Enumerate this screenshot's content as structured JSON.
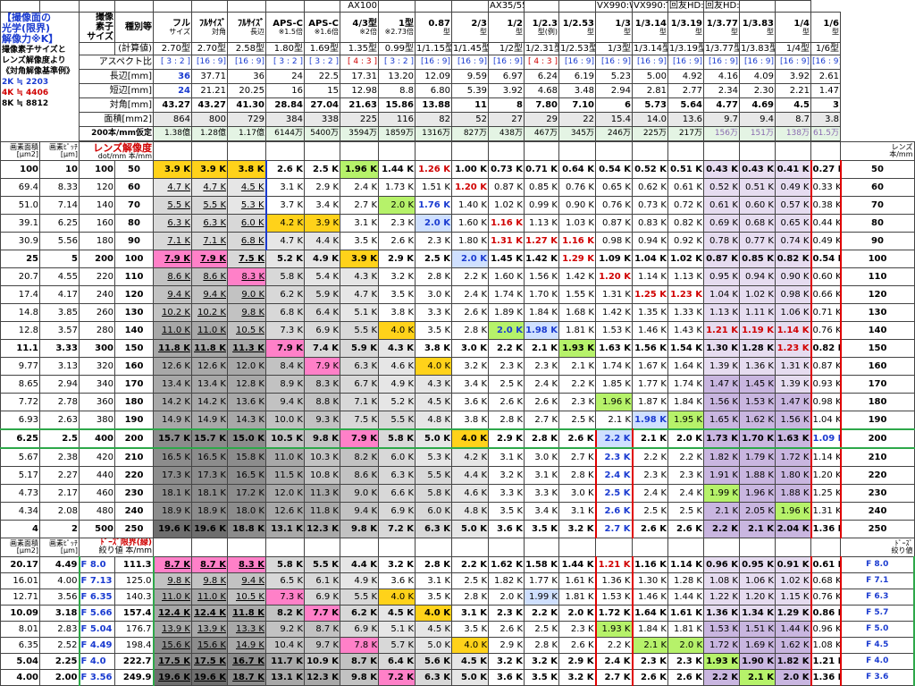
{
  "title_lines": [
    "【撮像面の",
    "光学(限界)",
    "解像力※K】",
    "撮像素子サイズと",
    "レンズ解像度より",
    "《対角解像基準例》",
    "2K ≒ 2203",
    "4K ≒ 4406",
    "8K ≒ 8812"
  ],
  "top_captions": {
    "ax100": "AX100",
    "ax35": "AX35/55",
    "vx990w": "VX990:W",
    "vx990t": "VX990:T",
    "hdw": "回友HD:W",
    "hdt": "回友HD:T"
  },
  "hdr_labels": {
    "sensor": "撮像",
    "element": "素子",
    "size": "サイズ",
    "type": "種別等",
    "calc": "(計算値)",
    "aspect": "アスペクト比",
    "long": "長辺[mm]",
    "short": "短辺[mm]",
    "diag": "対角[mm]",
    "area": "面積[mm2]",
    "pix200": "200本/mm仮定"
  },
  "columns": [
    {
      "name": "フル\nサイズ",
      "sub": "2.70型",
      "aspect": "[ 3 : 2 ]",
      "long": "36",
      "short": "24",
      "diag": "43.27",
      "area": "864",
      "pix": "1.38億"
    },
    {
      "name": "ﾌﾙｻｲｽﾞ\n対角",
      "sub": "2.70型",
      "aspect": "[16 : 9]",
      "long": "37.71",
      "short": "21.21",
      "diag": "43.27",
      "area": "800",
      "pix": "1.28億"
    },
    {
      "name": "ﾌﾙｻｲｽﾞ\n長辺",
      "sub": "2.58型",
      "aspect": "[16 : 9]",
      "long": "36",
      "short": "20.25",
      "diag": "41.30",
      "area": "729",
      "pix": "1.17億"
    },
    {
      "name": "APS-C\n※1.5倍",
      "sub": "1.80型",
      "aspect": "[ 3 : 2 ]",
      "long": "24",
      "short": "16",
      "diag": "28.84",
      "area": "384",
      "pix": "6144万"
    },
    {
      "name": "APS-C\n※1.6倍",
      "sub": "1.69型",
      "aspect": "[ 3 : 2 ]",
      "long": "22.5",
      "short": "15",
      "diag": "27.04",
      "area": "338",
      "pix": "5400万"
    },
    {
      "name": "4/3型\n※2倍",
      "sub": "1.35型",
      "aspect": "[ 4 : 3 ]",
      "long": "17.31",
      "short": "12.98",
      "diag": "21.63",
      "area": "225",
      "pix": "3594万"
    },
    {
      "name": "1型\n※2.73倍",
      "sub": "0.99型",
      "aspect": "[ 3 : 2 ]",
      "long": "13.20",
      "short": "8.8",
      "diag": "15.86",
      "area": "116",
      "pix": "1859万"
    },
    {
      "name": "0.87\n型",
      "sub": "1/1.15型",
      "aspect": "[16 : 9]",
      "long": "12.09",
      "short": "6.80",
      "diag": "13.88",
      "area": "82",
      "pix": "1316万"
    },
    {
      "name": "2/3\n型",
      "sub": "1/1.45型",
      "aspect": "[16 : 9]",
      "long": "9.59",
      "short": "5.39",
      "diag": "11",
      "area": "52",
      "pix": "827万"
    },
    {
      "name": "1/2\n型",
      "sub": "1/2型",
      "aspect": "[16 : 9]",
      "long": "6.97",
      "short": "3.92",
      "diag": "8",
      "area": "27",
      "pix": "438万"
    },
    {
      "name": "1/2.3\n型(例)",
      "sub": "1/2.31型",
      "aspect": "[ 4 : 3 ]",
      "long": "6.24",
      "short": "4.68",
      "diag": "7.80",
      "area": "29",
      "pix": "467万"
    },
    {
      "name": "1/2.53\n型",
      "sub": "1/2.53型",
      "aspect": "[16 : 9]",
      "long": "6.19",
      "short": "3.48",
      "diag": "7.10",
      "area": "22",
      "pix": "345万"
    },
    {
      "name": "1/3\n型",
      "sub": "1/3型",
      "aspect": "[16 : 9]",
      "long": "5.23",
      "short": "2.94",
      "diag": "6",
      "area": "15.4",
      "pix": "246万"
    },
    {
      "name": "1/3.14\n型",
      "sub": "1/3.14型",
      "aspect": "[16 : 9]",
      "long": "5.00",
      "short": "2.81",
      "diag": "5.73",
      "area": "14.0",
      "pix": "225万"
    },
    {
      "name": "1/3.19\n型",
      "sub": "1/3.19型",
      "aspect": "[16 : 9]",
      "long": "4.92",
      "short": "2.77",
      "diag": "5.64",
      "area": "13.6",
      "pix": "217万"
    },
    {
      "name": "1/3.77\n型",
      "sub": "1/3.77型",
      "aspect": "[16 : 9]",
      "long": "4.16",
      "short": "2.34",
      "diag": "4.77",
      "area": "9.7",
      "pix": "156万"
    },
    {
      "name": "1/3.83\n型",
      "sub": "1/3.83型",
      "aspect": "[16 : 9]",
      "long": "4.09",
      "short": "2.30",
      "diag": "4.69",
      "area": "9.4",
      "pix": "151万"
    },
    {
      "name": "1/4\n型",
      "sub": "1/4型",
      "aspect": "[16 : 9]",
      "long": "3.92",
      "short": "2.21",
      "diag": "4.5",
      "area": "8.7",
      "pix": "138万"
    },
    {
      "name": "1/6\n型",
      "sub": "1/6型",
      "aspect": "[16 : 9]",
      "long": "2.61",
      "short": "1.47",
      "diag": "3",
      "area": "3.8",
      "pix": "61.5万"
    }
  ],
  "res_header": {
    "area": "画素面積",
    "pitch": "画素ﾋﾟｯﾁ",
    "unit_area": "[μm2]",
    "unit_pitch": "[μm]",
    "dot": "dot/mm",
    "lines": "本/mm",
    "lens": "レンズ解像度",
    "lens_right": "レンズ",
    "lens_right_unit": "本/mm"
  },
  "rows": [
    {
      "a": "100",
      "p": "10",
      "d": "100",
      "l": "50",
      "bold": true,
      "v": [
        "3.9 K",
        "3.9 K",
        "3.8 K",
        "2.6 K",
        "2.5 K",
        "1.96 K",
        "1.44 K",
        "1.26 K",
        "1.00 K",
        "0.73 K",
        "0.71 K",
        "0.64 K",
        "0.54 K",
        "0.52 K",
        "0.51 K",
        "0.43 K",
        "0.43 K",
        "0.41 K",
        "0.27 K"
      ]
    },
    {
      "a": "69.4",
      "p": "8.33",
      "d": "120",
      "l": "60",
      "v": [
        "4.7 K",
        "4.7 K",
        "4.5 K",
        "3.1 K",
        "2.9 K",
        "2.4 K",
        "1.73 K",
        "1.51 K",
        "1.20 K",
        "0.87 K",
        "0.85 K",
        "0.76 K",
        "0.65 K",
        "0.62 K",
        "0.61 K",
        "0.52 K",
        "0.51 K",
        "0.49 K",
        "0.33 K"
      ]
    },
    {
      "a": "51.0",
      "p": "7.14",
      "d": "140",
      "l": "70",
      "v": [
        "5.5 K",
        "5.5 K",
        "5.3 K",
        "3.7 K",
        "3.4 K",
        "2.7 K",
        "2.0 K",
        "1.76 K",
        "1.40 K",
        "1.02 K",
        "0.99 K",
        "0.90 K",
        "0.76 K",
        "0.73 K",
        "0.72 K",
        "0.61 K",
        "0.60 K",
        "0.57 K",
        "0.38 K"
      ]
    },
    {
      "a": "39.1",
      "p": "6.25",
      "d": "160",
      "l": "80",
      "v": [
        "6.3 K",
        "6.3 K",
        "6.0 K",
        "4.2 K",
        "3.9 K",
        "3.1 K",
        "2.3 K",
        "2.0 K",
        "1.60 K",
        "1.16 K",
        "1.13 K",
        "1.03 K",
        "0.87 K",
        "0.83 K",
        "0.82 K",
        "0.69 K",
        "0.68 K",
        "0.65 K",
        "0.44 K"
      ]
    },
    {
      "a": "30.9",
      "p": "5.56",
      "d": "180",
      "l": "90",
      "v": [
        "7.1 K",
        "7.1 K",
        "6.8 K",
        "4.7 K",
        "4.4 K",
        "3.5 K",
        "2.6 K",
        "2.3 K",
        "1.80 K",
        "1.31 K",
        "1.27 K",
        "1.16 K",
        "0.98 K",
        "0.94 K",
        "0.92 K",
        "0.78 K",
        "0.77 K",
        "0.74 K",
        "0.49 K"
      ]
    },
    {
      "a": "25",
      "p": "5",
      "d": "200",
      "l": "100",
      "bold": true,
      "v": [
        "7.9 K",
        "7.9 K",
        "7.5 K",
        "5.2 K",
        "4.9 K",
        "3.9 K",
        "2.9 K",
        "2.5 K",
        "2.0 K",
        "1.45 K",
        "1.42 K",
        "1.29 K",
        "1.09 K",
        "1.04 K",
        "1.02 K",
        "0.87 K",
        "0.85 K",
        "0.82 K",
        "0.54 K"
      ]
    },
    {
      "a": "20.7",
      "p": "4.55",
      "d": "220",
      "l": "110",
      "v": [
        "8.6 K",
        "8.6 K",
        "8.3 K",
        "5.8 K",
        "5.4 K",
        "4.3 K",
        "3.2 K",
        "2.8 K",
        "2.2 K",
        "1.60 K",
        "1.56 K",
        "1.42 K",
        "1.20 K",
        "1.14 K",
        "1.13 K",
        "0.95 K",
        "0.94 K",
        "0.90 K",
        "0.60 K"
      ]
    },
    {
      "a": "17.4",
      "p": "4.17",
      "d": "240",
      "l": "120",
      "v": [
        "9.4 K",
        "9.4 K",
        "9.0 K",
        "6.2 K",
        "5.9 K",
        "4.7 K",
        "3.5 K",
        "3.0 K",
        "2.4 K",
        "1.74 K",
        "1.70 K",
        "1.55 K",
        "1.31 K",
        "1.25 K",
        "1.23 K",
        "1.04 K",
        "1.02 K",
        "0.98 K",
        "0.66 K"
      ]
    },
    {
      "a": "14.8",
      "p": "3.85",
      "d": "260",
      "l": "130",
      "v": [
        "10.2 K",
        "10.2 K",
        "9.8 K",
        "6.8 K",
        "6.4 K",
        "5.1 K",
        "3.8 K",
        "3.3 K",
        "2.6 K",
        "1.89 K",
        "1.84 K",
        "1.68 K",
        "1.42 K",
        "1.35 K",
        "1.33 K",
        "1.13 K",
        "1.11 K",
        "1.06 K",
        "0.71 K"
      ]
    },
    {
      "a": "12.8",
      "p": "3.57",
      "d": "280",
      "l": "140",
      "v": [
        "11.0 K",
        "11.0 K",
        "10.5 K",
        "7.3 K",
        "6.9 K",
        "5.5 K",
        "4.0 K",
        "3.5 K",
        "2.8 K",
        "2.0 K",
        "1.98 K",
        "1.81 K",
        "1.53 K",
        "1.46 K",
        "1.43 K",
        "1.21 K",
        "1.19 K",
        "1.14 K",
        "0.76 K"
      ]
    },
    {
      "a": "11.1",
      "p": "3.33",
      "d": "300",
      "l": "150",
      "bold": true,
      "v": [
        "11.8 K",
        "11.8 K",
        "11.3 K",
        "7.9 K",
        "7.4 K",
        "5.9 K",
        "4.3 K",
        "3.8 K",
        "3.0 K",
        "2.2 K",
        "2.1 K",
        "1.93 K",
        "1.63 K",
        "1.56 K",
        "1.54 K",
        "1.30 K",
        "1.28 K",
        "1.23 K",
        "0.82 K"
      ]
    },
    {
      "a": "9.77",
      "p": "3.13",
      "d": "320",
      "l": "160",
      "v": [
        "12.6 K",
        "12.6 K",
        "12.0 K",
        "8.4 K",
        "7.9 K",
        "6.3 K",
        "4.6 K",
        "4.0 K",
        "3.2 K",
        "2.3 K",
        "2.3 K",
        "2.1 K",
        "1.74 K",
        "1.67 K",
        "1.64 K",
        "1.39 K",
        "1.36 K",
        "1.31 K",
        "0.87 K"
      ]
    },
    {
      "a": "8.65",
      "p": "2.94",
      "d": "340",
      "l": "170",
      "v": [
        "13.4 K",
        "13.4 K",
        "12.8 K",
        "8.9 K",
        "8.3 K",
        "6.7 K",
        "4.9 K",
        "4.3 K",
        "3.4 K",
        "2.5 K",
        "2.4 K",
        "2.2 K",
        "1.85 K",
        "1.77 K",
        "1.74 K",
        "1.47 K",
        "1.45 K",
        "1.39 K",
        "0.93 K"
      ]
    },
    {
      "a": "7.72",
      "p": "2.78",
      "d": "360",
      "l": "180",
      "v": [
        "14.2 K",
        "14.2 K",
        "13.6 K",
        "9.4 K",
        "8.8 K",
        "7.1 K",
        "5.2 K",
        "4.5 K",
        "3.6 K",
        "2.6 K",
        "2.6 K",
        "2.3 K",
        "1.96 K",
        "1.87 K",
        "1.84 K",
        "1.56 K",
        "1.53 K",
        "1.47 K",
        "0.98 K"
      ]
    },
    {
      "a": "6.93",
      "p": "2.63",
      "d": "380",
      "l": "190",
      "v": [
        "14.9 K",
        "14.9 K",
        "14.3 K",
        "10.0 K",
        "9.3 K",
        "7.5 K",
        "5.5 K",
        "4.8 K",
        "3.8 K",
        "2.8 K",
        "2.7 K",
        "2.5 K",
        "2.1 K",
        "1.98 K",
        "1.95 K",
        "1.65 K",
        "1.62 K",
        "1.56 K",
        "1.04 K"
      ]
    },
    {
      "a": "6.25",
      "p": "2.5",
      "d": "400",
      "l": "200",
      "bold": true,
      "v": [
        "15.7 K",
        "15.7 K",
        "15.0 K",
        "10.5 K",
        "9.8 K",
        "7.9 K",
        "5.8 K",
        "5.0 K",
        "4.0 K",
        "2.9 K",
        "2.8 K",
        "2.6 K",
        "2.2 K",
        "2.1 K",
        "2.0 K",
        "1.73 K",
        "1.70 K",
        "1.63 K",
        "1.09 K"
      ]
    },
    {
      "a": "5.67",
      "p": "2.38",
      "d": "420",
      "l": "210",
      "v": [
        "16.5 K",
        "16.5 K",
        "15.8 K",
        "11.0 K",
        "10.3 K",
        "8.2 K",
        "6.0 K",
        "5.3 K",
        "4.2 K",
        "3.1 K",
        "3.0 K",
        "2.7 K",
        "2.3 K",
        "2.2 K",
        "2.2 K",
        "1.82 K",
        "1.79 K",
        "1.72 K",
        "1.14 K"
      ]
    },
    {
      "a": "5.17",
      "p": "2.27",
      "d": "440",
      "l": "220",
      "v": [
        "17.3 K",
        "17.3 K",
        "16.5 K",
        "11.5 K",
        "10.8 K",
        "8.6 K",
        "6.3 K",
        "5.5 K",
        "4.4 K",
        "3.2 K",
        "3.1 K",
        "2.8 K",
        "2.4 K",
        "2.3 K",
        "2.3 K",
        "1.91 K",
        "1.88 K",
        "1.80 K",
        "1.20 K"
      ]
    },
    {
      "a": "4.73",
      "p": "2.17",
      "d": "460",
      "l": "230",
      "v": [
        "18.1 K",
        "18.1 K",
        "17.2 K",
        "12.0 K",
        "11.3 K",
        "9.0 K",
        "6.6 K",
        "5.8 K",
        "4.6 K",
        "3.3 K",
        "3.3 K",
        "3.0 K",
        "2.5 K",
        "2.4 K",
        "2.4 K",
        "1.99 K",
        "1.96 K",
        "1.88 K",
        "1.25 K"
      ]
    },
    {
      "a": "4.34",
      "p": "2.08",
      "d": "480",
      "l": "240",
      "v": [
        "18.9 K",
        "18.9 K",
        "18.0 K",
        "12.6 K",
        "11.8 K",
        "9.4 K",
        "6.9 K",
        "6.0 K",
        "4.8 K",
        "3.5 K",
        "3.4 K",
        "3.1 K",
        "2.6 K",
        "2.5 K",
        "2.5 K",
        "2.1 K",
        "2.05 K",
        "1.96 K",
        "1.31 K"
      ]
    },
    {
      "a": "4",
      "p": "2",
      "d": "500",
      "l": "250",
      "bold": true,
      "v": [
        "19.6 K",
        "19.6 K",
        "18.8 K",
        "13.1 K",
        "12.3 K",
        "9.8 K",
        "7.2 K",
        "6.3 K",
        "5.0 K",
        "3.6 K",
        "3.5 K",
        "3.2 K",
        "2.7 K",
        "2.6 K",
        "2.6 K",
        "2.2 K",
        "2.1 K",
        "2.04 K",
        "1.36 K"
      ]
    }
  ],
  "f_header": {
    "area": "画素面積",
    "pitch": "画素ﾋﾟｯﾁ",
    "unit_area": "[μm2]",
    "unit_pitch": "[μm]",
    "label": "ﾄﾞｰｽﾞ限界",
    "sub": "(緑)",
    "aperture": "絞り値",
    "lines": "本/mm",
    "right": "ﾄﾞｰｽﾞ",
    "right_sub": "絞り値"
  },
  "frows": [
    {
      "a": "20.17",
      "p": "4.49",
      "f": "F 8.0",
      "l": "111.3",
      "bold": true,
      "v": [
        "8.7 K",
        "8.7 K",
        "8.3 K",
        "5.8 K",
        "5.5 K",
        "4.4 K",
        "3.2 K",
        "2.8 K",
        "2.2 K",
        "1.62 K",
        "1.58 K",
        "1.44 K",
        "1.21 K",
        "1.16 K",
        "1.14 K",
        "0.96 K",
        "0.95 K",
        "0.91 K",
        "0.61 K"
      ]
    },
    {
      "a": "16.01",
      "p": "4.00",
      "f": "F 7.13",
      "l": "125.0",
      "v": [
        "9.8 K",
        "9.8 K",
        "9.4 K",
        "6.5 K",
        "6.1 K",
        "4.9 K",
        "3.6 K",
        "3.1 K",
        "2.5 K",
        "1.82 K",
        "1.77 K",
        "1.61 K",
        "1.36 K",
        "1.30 K",
        "1.28 K",
        "1.08 K",
        "1.06 K",
        "1.02 K",
        "0.68 K"
      ]
    },
    {
      "a": "12.71",
      "p": "3.56",
      "f": "F 6.35",
      "l": "140.3",
      "v": [
        "11.0 K",
        "11.0 K",
        "10.5 K",
        "7.3 K",
        "6.9 K",
        "5.5 K",
        "4.0 K",
        "3.5 K",
        "2.8 K",
        "2.0 K",
        "1.99 K",
        "1.81 K",
        "1.53 K",
        "1.46 K",
        "1.44 K",
        "1.22 K",
        "1.20 K",
        "1.15 K",
        "0.76 K"
      ]
    },
    {
      "a": "10.09",
      "p": "3.18",
      "f": "F 5.66",
      "l": "157.4",
      "bold": true,
      "v": [
        "12.4 K",
        "12.4 K",
        "11.8 K",
        "8.2 K",
        "7.7 K",
        "6.2 K",
        "4.5 K",
        "4.0 K",
        "3.1 K",
        "2.3 K",
        "2.2 K",
        "2.0 K",
        "1.72 K",
        "1.64 K",
        "1.61 K",
        "1.36 K",
        "1.34 K",
        "1.29 K",
        "0.86 K"
      ]
    },
    {
      "a": "8.01",
      "p": "2.83",
      "f": "F 5.04",
      "l": "176.7",
      "v": [
        "13.9 K",
        "13.9 K",
        "13.3 K",
        "9.2 K",
        "8.7 K",
        "6.9 K",
        "5.1 K",
        "4.5 K",
        "3.5 K",
        "2.6 K",
        "2.5 K",
        "2.3 K",
        "1.93 K",
        "1.84 K",
        "1.81 K",
        "1.53 K",
        "1.51 K",
        "1.44 K",
        "0.96 K"
      ]
    },
    {
      "a": "6.35",
      "p": "2.52",
      "f": "F 4.49",
      "l": "198.4",
      "v": [
        "15.6 K",
        "15.6 K",
        "14.9 K",
        "10.4 K",
        "9.7 K",
        "7.8 K",
        "5.7 K",
        "5.0 K",
        "4.0 K",
        "2.9 K",
        "2.8 K",
        "2.6 K",
        "2.2 K",
        "2.1 K",
        "2.0 K",
        "1.72 K",
        "1.69 K",
        "1.62 K",
        "1.08 K"
      ]
    },
    {
      "a": "5.04",
      "p": "2.25",
      "f": "F 4.0",
      "l": "222.7",
      "bold": true,
      "v": [
        "17.5 K",
        "17.5 K",
        "16.7 K",
        "11.7 K",
        "10.9 K",
        "8.7 K",
        "6.4 K",
        "5.6 K",
        "4.5 K",
        "3.2 K",
        "3.2 K",
        "2.9 K",
        "2.4 K",
        "2.3 K",
        "2.3 K",
        "1.93 K",
        "1.90 K",
        "1.82 K",
        "1.21 K"
      ]
    },
    {
      "a": "4.00",
      "p": "2.00",
      "f": "F 3.56",
      "l": "249.9",
      "bold": true,
      "v": [
        "19.6 K",
        "19.6 K",
        "18.7 K",
        "13.1 K",
        "12.3 K",
        "9.8 K",
        "7.2 K",
        "6.3 K",
        "5.0 K",
        "3.6 K",
        "3.5 K",
        "3.2 K",
        "2.7 K",
        "2.6 K",
        "2.6 K",
        "2.2 K",
        "2.1 K",
        "2.0 K",
        "1.36 K"
      ]
    }
  ],
  "f_right": [
    "F 8.0",
    "F 7.1",
    "F 6.3",
    "F 5.7",
    "F 5.0",
    "F 4.5",
    "F 4.0",
    "F 3.6"
  ],
  "colors": {
    "blue_frame": "#1a3bd0",
    "red_frame": "#e00000",
    "green_frame": "#2ea84a",
    "yellow": "#ffd21a",
    "pink": "#ff80c8",
    "green": "#b6f26a"
  }
}
